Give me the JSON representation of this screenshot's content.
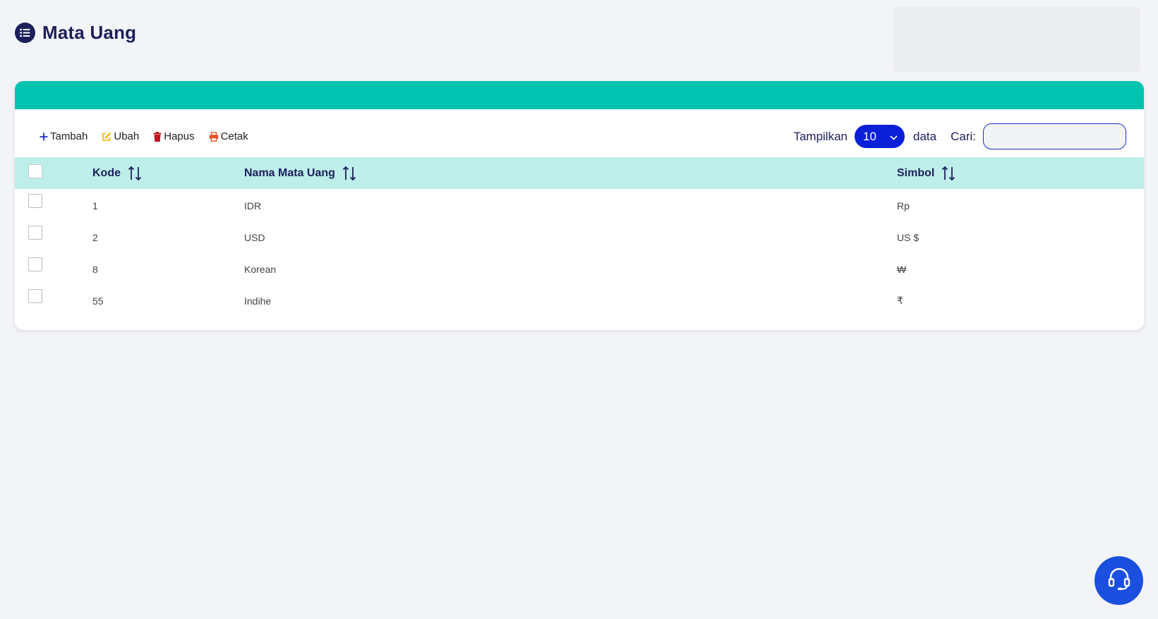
{
  "header": {
    "title": "Mata Uang",
    "title_icon": "list-icon"
  },
  "toolbar": {
    "actions": [
      {
        "label": "Tambah",
        "icon": "plus-icon",
        "color": "#1a2fc4"
      },
      {
        "label": "Ubah",
        "icon": "edit-icon",
        "color": "#f2b000"
      },
      {
        "label": "Hapus",
        "icon": "trash-icon",
        "color": "#c0151b"
      },
      {
        "label": "Cetak",
        "icon": "print-icon",
        "color": "#e8542a"
      }
    ],
    "show_label": "Tampilkan",
    "page_size": "10",
    "data_label": "data",
    "search_label": "Cari:",
    "search_value": ""
  },
  "table": {
    "columns": [
      "Kode",
      "Nama Mata Uang",
      "Simbol"
    ],
    "rows": [
      {
        "kode": "1",
        "nama": "IDR",
        "simbol": "Rp"
      },
      {
        "kode": "2",
        "nama": "USD",
        "simbol": "US $"
      },
      {
        "kode": "8",
        "nama": "Korean",
        "simbol": "₩"
      },
      {
        "kode": "55",
        "nama": "Indihe",
        "simbol": "₹"
      }
    ]
  },
  "colors": {
    "accent_teal": "#00c4b0",
    "header_row": "#bdeee9",
    "primary_blue": "#0a1fd8",
    "navy_text": "#1c1f5a",
    "support_button": "#1a4fe0"
  },
  "support": {
    "icon": "headset-icon"
  }
}
